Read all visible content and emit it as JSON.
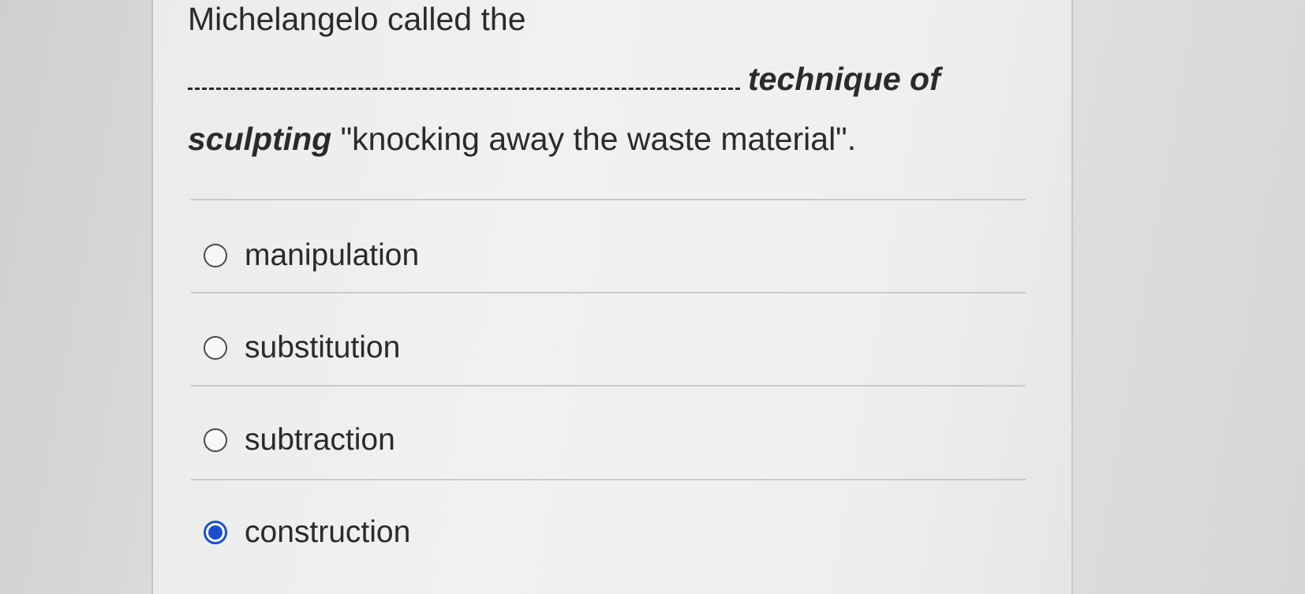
{
  "question": {
    "line1": "Michelangelo called the",
    "line2_after_blank": "technique of",
    "line3_italic": "sculpting",
    "line3_rest": " \"knocking away the waste material\"."
  },
  "options": [
    {
      "label": "manipulation",
      "selected": false
    },
    {
      "label": "substitution",
      "selected": false
    },
    {
      "label": "subtraction",
      "selected": false
    },
    {
      "label": "construction",
      "selected": true
    }
  ],
  "colors": {
    "selected_radio": "#1a4fcf",
    "text": "#2a2a2c"
  }
}
